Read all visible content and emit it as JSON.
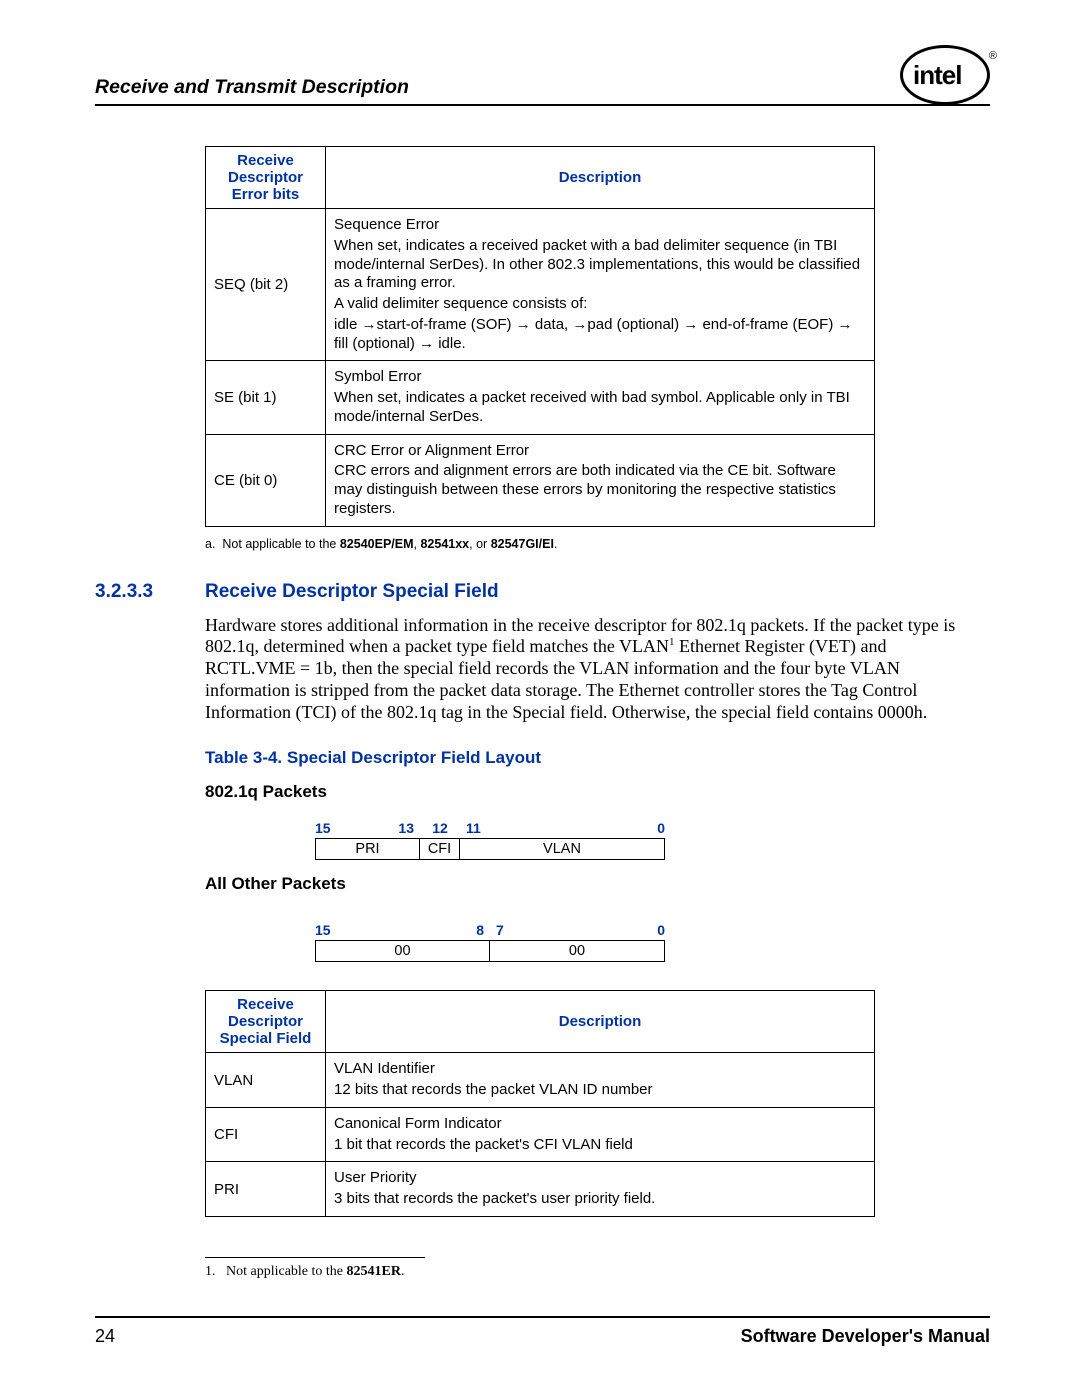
{
  "header": {
    "title": "Receive and Transmit Description",
    "logo_text": "intel"
  },
  "table1": {
    "head1": "Receive Descriptor Error bits",
    "head2": "Description",
    "rows": [
      {
        "bit": "SEQ (bit 2)",
        "lines": [
          "Sequence Error",
          "When set, indicates a received packet with a bad delimiter sequence (in TBI mode/internal SerDes). In other 802.3 implementations, this would be classified as a framing error.",
          "A valid delimiter sequence consists of:",
          "idle →start-of-frame (SOF) → data, →pad (optional) → end-of-frame (EOF) → fill (optional) → idle."
        ]
      },
      {
        "bit": "SE (bit 1)",
        "lines": [
          "Symbol Error",
          "When set, indicates a packet received with bad symbol. Applicable only in TBI mode/internal SerDes."
        ]
      },
      {
        "bit": "CE (bit 0)",
        "lines": [
          "CRC Error or Alignment Error",
          "CRC errors and alignment errors are both indicated via the CE bit. Software may distinguish between these errors by monitoring the respective statistics registers."
        ]
      }
    ],
    "note_label": "a.",
    "note_pre": "Not applicable to the ",
    "note_bold": "82540EP/EM",
    "note_mid": ", ",
    "note_bold2": "82541xx",
    "note_mid2": ", or ",
    "note_bold3": "82547GI/EI",
    "note_end": "."
  },
  "section": {
    "num": "3.2.3.3",
    "title": "Receive Descriptor Special Field",
    "para": "Hardware stores additional information in the receive descriptor for 802.1q packets. If the packet type is 802.1q, determined when a packet type field matches the VLAN",
    "para_sup": "1",
    "para_cont": " Ethernet Register (VET) and RCTL.VME = 1b, then the special field records the VLAN information and the four byte VLAN information is stripped from the packet data storage. The Ethernet controller stores the Tag Control Information (TCI) of the 802.1q tag in the Special field. Otherwise, the special field contains 0000h."
  },
  "table_caption": "Table 3-4. Special Descriptor Field Layout",
  "sub1": "802.1q Packets",
  "bitfield1": {
    "labels": [
      "15",
      "13",
      "12",
      "11",
      "0"
    ],
    "cells": [
      "PRI",
      "CFI",
      "VLAN"
    ]
  },
  "sub2": "All Other Packets",
  "bitfield2": {
    "labels": [
      "15",
      "8",
      "7",
      "0"
    ],
    "cells": [
      "00",
      "00"
    ]
  },
  "table2": {
    "head1": "Receive Descriptor Special Field",
    "head2": "Description",
    "rows": [
      {
        "name": "VLAN",
        "l1": "VLAN Identifier",
        "l2": "12 bits that records the packet VLAN ID number"
      },
      {
        "name": "CFI",
        "l1": "Canonical Form Indicator",
        "l2": "1 bit that records the packet's CFI VLAN field"
      },
      {
        "name": "PRI",
        "l1": "User Priority",
        "l2": "3 bits that records the packet's user priority field."
      }
    ]
  },
  "footnote": {
    "num": "1.",
    "pre": "Not applicable to the ",
    "bold": "82541ER",
    "end": "."
  },
  "footer": {
    "page": "24",
    "title": "Software Developer's Manual"
  }
}
